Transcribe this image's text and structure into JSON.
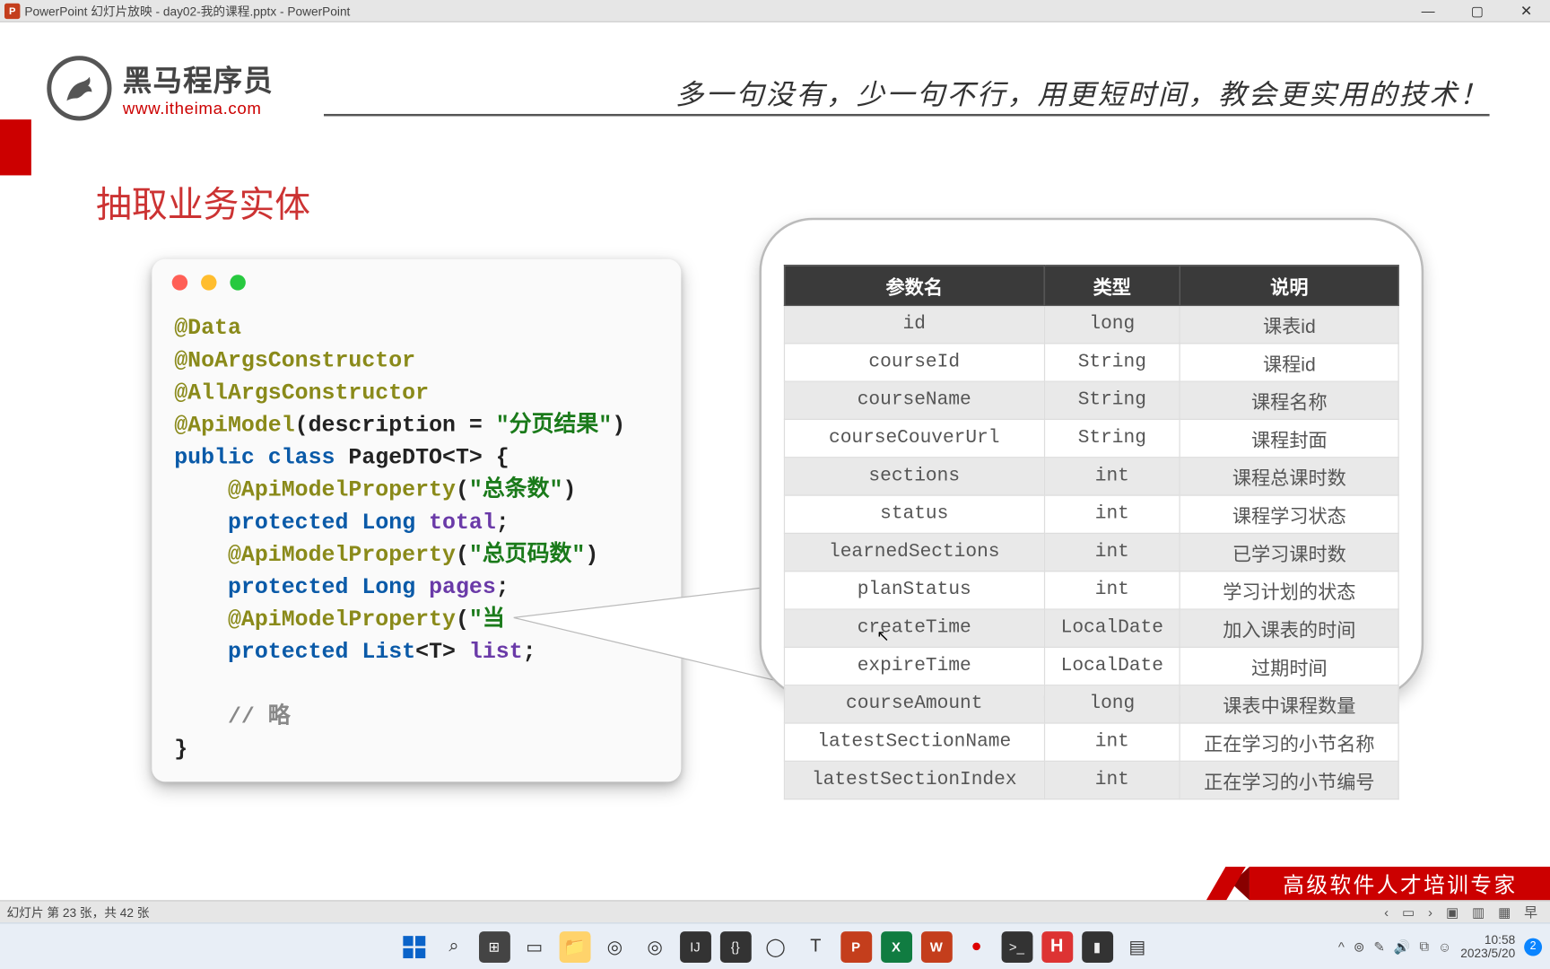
{
  "titlebar": {
    "pp_badge": "P",
    "title": "PowerPoint 幻灯片放映  -  day02-我的课程.pptx - PowerPoint",
    "min": "—",
    "max": "▢",
    "close": "✕"
  },
  "header": {
    "logo_cn": "黑马程序员",
    "logo_en": "www.itheima.com",
    "slogan": "多一句没有，少一句不行，用更短时间，教会更实用的技术！"
  },
  "section_title": "抽取业务实体",
  "code": {
    "l1a": "@Data",
    "l2a": "@NoArgsConstructor",
    "l3a": "@AllArgsConstructor",
    "l4a": "@ApiModel",
    "l4b": "(description = ",
    "l4c": "\"分页结果\"",
    "l4d": ")",
    "l5a": "public class ",
    "l5b": "PageDTO",
    "l5c": "<T> {",
    "l6a": "    ",
    "l6b": "@ApiModelProperty",
    "l6c": "(",
    "l6d": "\"总条数\"",
    "l6e": ")",
    "l7a": "    ",
    "l7b": "protected ",
    "l7c": "Long ",
    "l7d": "total",
    "l7e": ";",
    "l8a": "    ",
    "l8b": "@ApiModelProperty",
    "l8c": "(",
    "l8d": "\"总页码数\"",
    "l8e": ")",
    "l9a": "    ",
    "l9b": "protected ",
    "l9c": "Long ",
    "l9d": "pages",
    "l9e": ";",
    "l10a": "    ",
    "l10b": "@ApiModelProperty",
    "l10c": "(",
    "l10d": "\"当",
    "l10e": "",
    "l11a": "    ",
    "l11b": "protected ",
    "l11c": "List",
    "l11c2": "<T> ",
    "l11d": "list",
    "l11e": ";",
    "l12": "",
    "l13a": "    ",
    "l13b": "// 略",
    "l14": "}"
  },
  "table": {
    "h1": "参数名",
    "h2": "类型",
    "h3": "说明",
    "rows": [
      {
        "n": "id",
        "t": "long",
        "d": "课表id"
      },
      {
        "n": "courseId",
        "t": "String",
        "d": "课程id"
      },
      {
        "n": "courseName",
        "t": "String",
        "d": "课程名称"
      },
      {
        "n": "courseCouverUrl",
        "t": "String",
        "d": "课程封面"
      },
      {
        "n": "sections",
        "t": "int",
        "d": "课程总课时数"
      },
      {
        "n": "status",
        "t": "int",
        "d": "课程学习状态"
      },
      {
        "n": "learnedSections",
        "t": "int",
        "d": "已学习课时数"
      },
      {
        "n": "planStatus",
        "t": "int",
        "d": "学习计划的状态"
      },
      {
        "n": "createTime",
        "t": "LocalDate",
        "d": "加入课表的时间"
      },
      {
        "n": "expireTime",
        "t": "LocalDate",
        "d": "过期时间"
      },
      {
        "n": "courseAmount",
        "t": "long",
        "d": "课表中课程数量"
      },
      {
        "n": "latestSectionName",
        "t": "int",
        "d": "正在学习的小节名称"
      },
      {
        "n": "latestSectionIndex",
        "t": "int",
        "d": "正在学习的小节编号"
      }
    ]
  },
  "ribbon": "高级软件人才培训专家",
  "statusbar": {
    "left": "幻灯片 第 23 张，共 42 张",
    "prev": "‹",
    "thumb": "▭",
    "next": "›",
    "v1": "▣",
    "v2": "▥",
    "v3": "▦",
    "v4": "早"
  },
  "taskbar": {
    "center_icons": {
      "search": "⌕",
      "taskview": "⊞",
      "widgets": "▭",
      "explorer": "📁",
      "chrome": "◎",
      "chrome2": "◎",
      "ij": "IJ",
      "code": "{}",
      "gh": "◯",
      "t": "T",
      "pp": "P",
      "xl": "X",
      "wd": "W",
      "rec": "●",
      "term": ">_",
      "h": "H",
      "term2": "▮",
      "note": "▤"
    },
    "tray": {
      "chev": "^",
      "wifi": "⊚",
      "mic": "✎",
      "vol": "🔊",
      "net": "⧉",
      "ime": "☺",
      "time": "10:58",
      "date": "2023/5/20",
      "notif": "2"
    }
  }
}
